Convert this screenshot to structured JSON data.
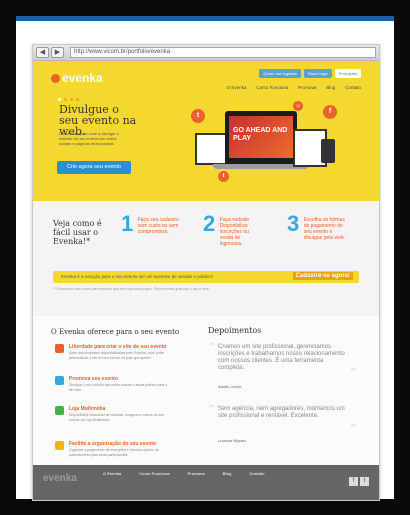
{
  "browser": {
    "url": "http://www.vicom.br/portfolio/evenka",
    "back_icon": "back-arrow-icon",
    "forward_icon": "forward-arrow-icon"
  },
  "site": {
    "logo_text": "evenka",
    "top_buttons": {
      "subscribe": "Quero me registrar",
      "login": "Fazer login",
      "language": "Português"
    },
    "nav": [
      "O Evenka",
      "Como Funciona",
      "Promova",
      "Blog",
      "Contato"
    ],
    "hero": {
      "headline": "Divulgue o seu evento na web.",
      "description": "O Evenka ajuda você a divulgar o website do seu evento em redes sociais e páginas relacionadas.",
      "cta": "Crie agora seu evento",
      "screen_text": "GO AHEAD AND PLAY"
    },
    "how": {
      "question": "Veja como é fácil usar o Evenka!*",
      "steps": [
        {
          "n": "1",
          "text": "Faça seu cadastro sem custo ou sem compromisso."
        },
        {
          "n": "2",
          "text": "Faça website Disponibilize inscrições ou venda de ingressos."
        },
        {
          "n": "3",
          "text": "Escolha as formas de pagamento do seu evento e divulgue pela web."
        }
      ],
      "banner_text": "Evenka é a solução para o seu evento ser um sucesso de vendas e público!",
      "banner_button": "Cadastre-se agora!",
      "fine_print": "*O Evenka só tem custo para eventos que tem ingressos pagos. Para eventos gratuitos o uso é livre."
    },
    "features": {
      "title": "O Evenka oferece para o seu evento",
      "items": [
        {
          "title": "Liberdade para criar o site do seu evento",
          "desc": "Além dos templates disponibilizados pelo Evenka, você pode personalizar o site do seu evento do jeito que quiser!",
          "color": "#e9612b"
        },
        {
          "title": "Promova seu evento",
          "desc": "Divulgue o seu evento nas redes sociais e atraia público para o seu site.",
          "color": "#35a8e0"
        },
        {
          "title": "Loja Multimídia",
          "desc": "Disponibilize download de músicas, imagens e vídeos do seu evento na Loja Multimídia.",
          "color": "#48b04a"
        },
        {
          "title": "Facilite a organização do seu evento",
          "desc": "Organize o pagamento de inscrições e ofereça opções de parcelamento para seus participantes.",
          "color": "#f2b800"
        }
      ]
    },
    "testimonials": {
      "title": "Depoimentos",
      "items": [
        {
          "text": "Criamos um site profissional, gerenciamos inscrições e trabalhamos nosso relacionamento com nossos clientes. É uma ferramenta completa.",
          "author": "Adolfo Junior"
        },
        {
          "text": "Sem agência, nem agregadores, montamos um site profissional e rentável. Excelente.",
          "author": "Luciana Miguez"
        }
      ]
    },
    "footer": {
      "logo": "evenka",
      "columns": [
        {
          "title": "O Evenka"
        },
        {
          "title": "Como Funciona"
        },
        {
          "title": "Promova"
        },
        {
          "title": "Blog"
        },
        {
          "title": "Contato"
        }
      ],
      "social_icons": [
        "facebook-icon",
        "twitter-icon"
      ]
    }
  }
}
